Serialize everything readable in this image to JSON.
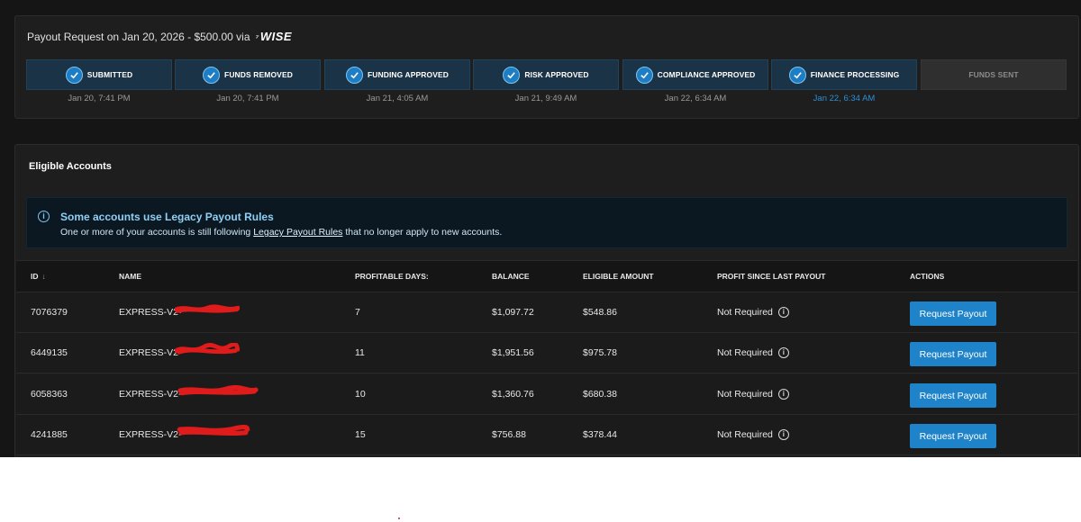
{
  "payout": {
    "title": "Payout Request on Jan 20, 2026 - $500.00 via",
    "provider_logo": "WISE",
    "steps": [
      {
        "label": "SUBMITTED",
        "date": "Jan 20, 7:41 PM",
        "status": "done"
      },
      {
        "label": "FUNDS REMOVED",
        "date": "Jan 20, 7:41 PM",
        "status": "done"
      },
      {
        "label": "FUNDING APPROVED",
        "date": "Jan 21, 4:05 AM",
        "status": "done"
      },
      {
        "label": "RISK APPROVED",
        "date": "Jan 21, 9:49 AM",
        "status": "done"
      },
      {
        "label": "COMPLIANCE APPROVED",
        "date": "Jan 22, 6:34 AM",
        "status": "done"
      },
      {
        "label": "FINANCE PROCESSING",
        "date": "Jan 22, 6:34 AM",
        "status": "active"
      },
      {
        "label": "FUNDS SENT",
        "date": "",
        "status": "pending"
      }
    ]
  },
  "eligible": {
    "heading": "Eligible Accounts",
    "notice": {
      "title": "Some accounts use Legacy Payout Rules",
      "desc_before": "One or more of your accounts is still following",
      "link": "Legacy Payout Rules",
      "desc_after": "that no longer apply to new accounts."
    },
    "columns": {
      "id": "ID",
      "name": "NAME",
      "profitable_days": "PROFITABLE DAYS:",
      "balance": "BALANCE",
      "eligible_amount": "ELIGIBLE AMOUNT",
      "profit_since": "PROFIT SINCE LAST PAYOUT",
      "actions": "ACTIONS"
    },
    "rows": [
      {
        "id": "7076379",
        "name": "EXPRESS-V2-",
        "days": "7",
        "balance": "$1,097.72",
        "eligible": "$548.86",
        "profit": "Not Required",
        "action": "Request Payout"
      },
      {
        "id": "6449135",
        "name": "EXPRESS-V2-",
        "days": "11",
        "balance": "$1,951.56",
        "eligible": "$975.78",
        "profit": "Not Required",
        "action": "Request Payout"
      },
      {
        "id": "6058363",
        "name": "EXPRESS-V2-",
        "days": "10",
        "balance": "$1,360.76",
        "eligible": "$680.38",
        "profit": "Not Required",
        "action": "Request Payout"
      },
      {
        "id": "4241885",
        "name": "EXPRESS-V2-",
        "days": "15",
        "balance": "$756.88",
        "eligible": "$378.44",
        "profit": "Not Required",
        "action": "Request Payout"
      }
    ]
  },
  "colors": {
    "accent": "#1e83c9",
    "active_date": "#2c8fd6",
    "redaction": "#e01b1b"
  }
}
